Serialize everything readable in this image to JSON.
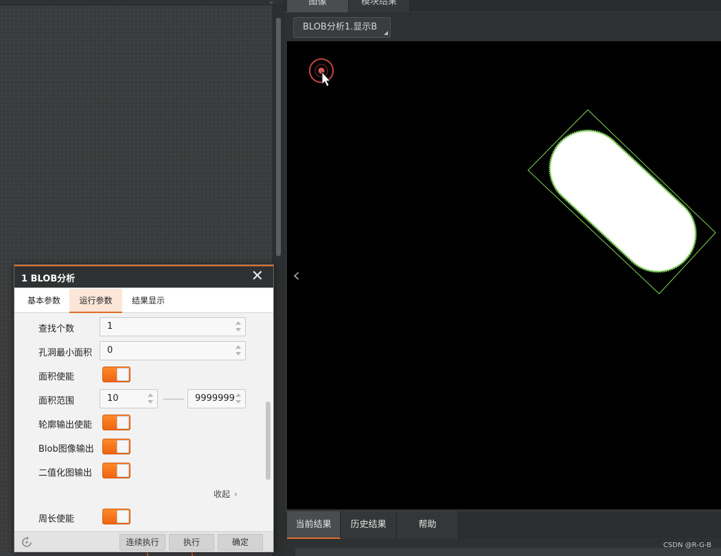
{
  "right_panel": {
    "image_tabs": [
      "图像",
      "模块结果"
    ],
    "image_selector": "BLOB分析1.显示B",
    "result_tabs": [
      "当前结果",
      "历史结果",
      "帮助"
    ],
    "watermark": "CSDN @R-G-B"
  },
  "dialog": {
    "title": "1 BLOB分析",
    "close_symbol": "✕",
    "tabs": [
      "基本参数",
      "运行参数",
      "结果显示"
    ],
    "active_tab": "运行参数",
    "params": {
      "find_count": {
        "label": "查找个数",
        "value": "1"
      },
      "hole_min_area": {
        "label": "孔洞最小面积",
        "value": "0"
      },
      "area_enable": {
        "label": "面积使能",
        "on": true
      },
      "area_range": {
        "label": "面积范围",
        "min": "10",
        "max": "9999999"
      },
      "contour_output_enable": {
        "label": "轮廓输出使能",
        "on": true
      },
      "blob_image_output": {
        "label": "Blob图像输出",
        "on": true
      },
      "binary_image_output": {
        "label": "二值化图输出",
        "on": true
      },
      "collapse_label": "收起",
      "perimeter_enable": {
        "label": "周长使能",
        "on": true
      }
    },
    "footer": {
      "continuous_execute": "连续执行",
      "execute": "执行",
      "confirm": "确定"
    }
  },
  "colors": {
    "accent": "#e06a28",
    "toggle_on": "#f47a1e",
    "blob_outline": "#7ed957",
    "blob_fill": "#ffffff"
  }
}
